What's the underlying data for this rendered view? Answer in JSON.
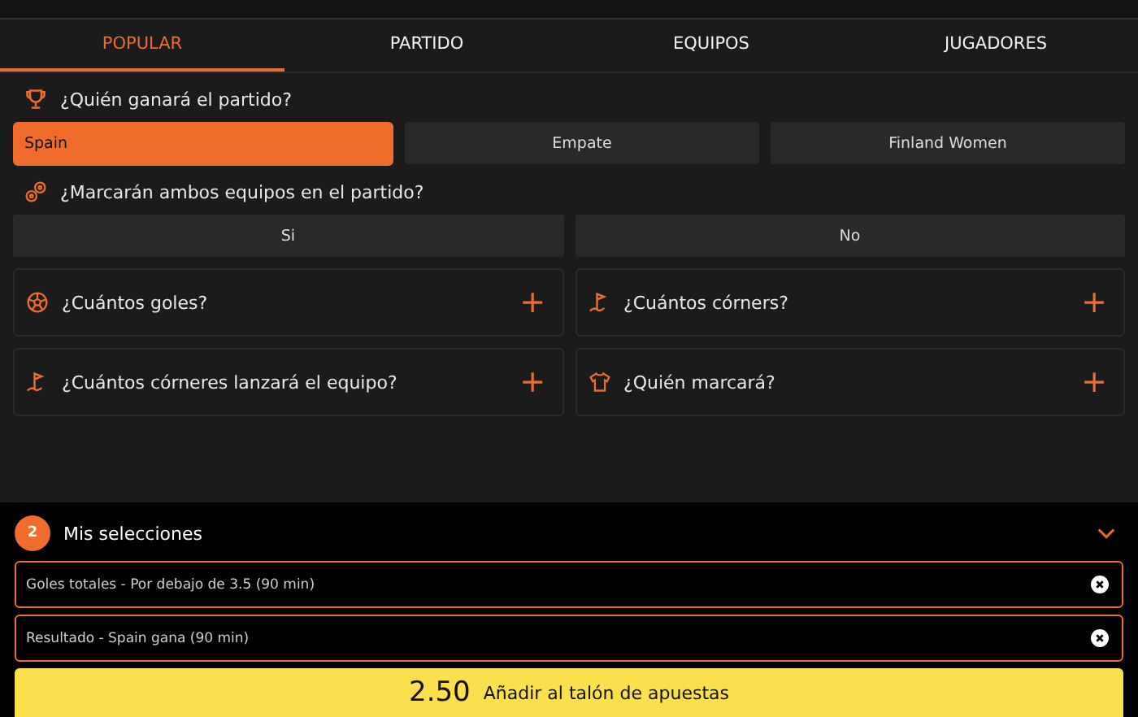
{
  "tabs": [
    {
      "label": "POPULAR",
      "selected": true
    },
    {
      "label": "PARTIDO",
      "selected": false
    },
    {
      "label": "EQUIPOS",
      "selected": false
    },
    {
      "label": "JUGADORES",
      "selected": false
    }
  ],
  "markets": [
    {
      "kind": "trophy",
      "question": "¿Quién ganará el partido?",
      "options": [
        {
          "label": "Spain",
          "selected": true
        },
        {
          "label": "Empate",
          "selected": false
        },
        {
          "label": "Finland Women",
          "selected": false
        }
      ]
    },
    {
      "kind": "balls",
      "question": "¿Marcarán ambos equipos en el partido?",
      "options": [
        {
          "label": "Si",
          "selected": false
        },
        {
          "label": "No",
          "selected": false
        }
      ]
    }
  ],
  "collapsed_markets": [
    {
      "kind": "ball",
      "question": "¿Cuántos goles?",
      "action": "+"
    },
    {
      "kind": "flag",
      "question": "¿Cuántos córners?",
      "action": "+"
    },
    {
      "kind": "flag",
      "question": "¿Cuántos córneres lanzará el equipo?",
      "action": "+"
    },
    {
      "kind": "shirt",
      "question": "¿Quién marcará?",
      "action": "+"
    }
  ],
  "betslip": {
    "count": "2",
    "title": "Mis selecciones",
    "expanded": true,
    "selections": [
      {
        "text": "Goles totales - Por debajo de 3.5 (90 min)"
      },
      {
        "text": "Resultado - Spain gana (90 min)"
      }
    ],
    "odds": "2.50",
    "action": "Añadir al talón de apuestas"
  }
}
